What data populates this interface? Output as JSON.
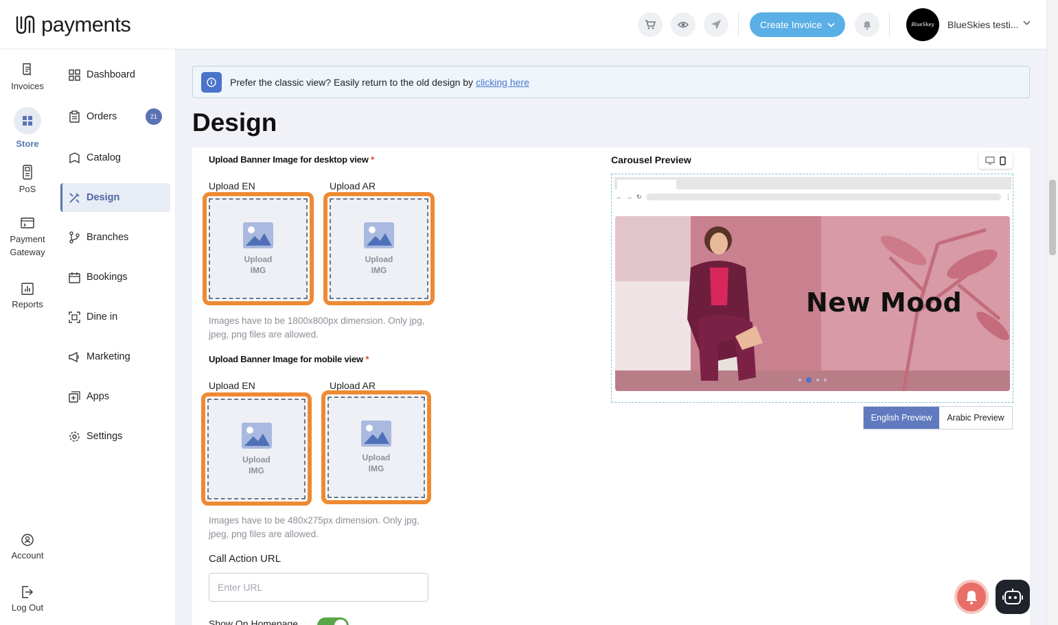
{
  "app": {
    "logo": "payments"
  },
  "topbar": {
    "create_invoice": "Create Invoice",
    "account_name": "BlueSkies testi...",
    "avatar_text": "BlueSkey",
    "icons": [
      "cart-icon",
      "eye-icon",
      "send-icon",
      "bell-icon"
    ]
  },
  "rail": {
    "items": [
      {
        "label": "Invoices",
        "icon": "invoice-icon"
      },
      {
        "label": "Store",
        "icon": "store-icon",
        "active": true
      },
      {
        "label": "PoS",
        "icon": "pos-icon"
      },
      {
        "label": "Payment Gateway",
        "icon": "payment-gateway-icon"
      },
      {
        "label": "Reports",
        "icon": "reports-icon"
      },
      {
        "label": "Account",
        "icon": "account-icon"
      },
      {
        "label": "Log Out",
        "icon": "logout-icon"
      }
    ]
  },
  "nav": {
    "items": [
      {
        "label": "Dashboard",
        "icon": "dashboard-icon"
      },
      {
        "label": "Orders",
        "icon": "orders-icon",
        "badge": "21"
      },
      {
        "label": "Catalog",
        "icon": "catalog-icon"
      },
      {
        "label": "Design",
        "icon": "design-icon",
        "active": true
      },
      {
        "label": "Branches",
        "icon": "branches-icon"
      },
      {
        "label": "Bookings",
        "icon": "bookings-icon"
      },
      {
        "label": "Dine in",
        "icon": "dine-in-icon"
      },
      {
        "label": "Marketing",
        "icon": "marketing-icon"
      },
      {
        "label": "Apps",
        "icon": "apps-icon"
      },
      {
        "label": "Settings",
        "icon": "settings-icon"
      }
    ]
  },
  "banner": {
    "text": "Prefer the classic view? Easily return to the old design by",
    "link": "clicking here"
  },
  "page": {
    "title": "Design"
  },
  "desktop_upload": {
    "title": "Upload Banner Image for desktop view",
    "required": "*",
    "en_label": "Upload EN",
    "ar_label": "Upload AR",
    "upload_text": "Upload IMG",
    "hint": "Images have to be 1800x800px dimension. Only jpg, jpeg, png files are allowed."
  },
  "mobile_upload": {
    "title": "Upload Banner Image for mobile view",
    "required": "*",
    "en_label": "Upload EN",
    "ar_label": "Upload AR",
    "upload_text": "Upload IMG",
    "hint": "Images have to be 480x275px dimension. Only jpg, jpeg, png files are allowed."
  },
  "cta": {
    "label": "Call Action URL",
    "placeholder": "Enter URL",
    "value": ""
  },
  "homepage": {
    "label": "Show On Homepage",
    "enabled": true
  },
  "preview": {
    "title": "Carousel Preview",
    "hero_text": "New Mood",
    "english_btn": "English Preview",
    "arabic_btn": "Arabic Preview",
    "selected": "English Preview"
  },
  "colors": {
    "accent": "#5b73b3",
    "create_btn": "#5aafe6",
    "upload_border": "#ee8a33",
    "hero_bg": "#d98e9c"
  }
}
